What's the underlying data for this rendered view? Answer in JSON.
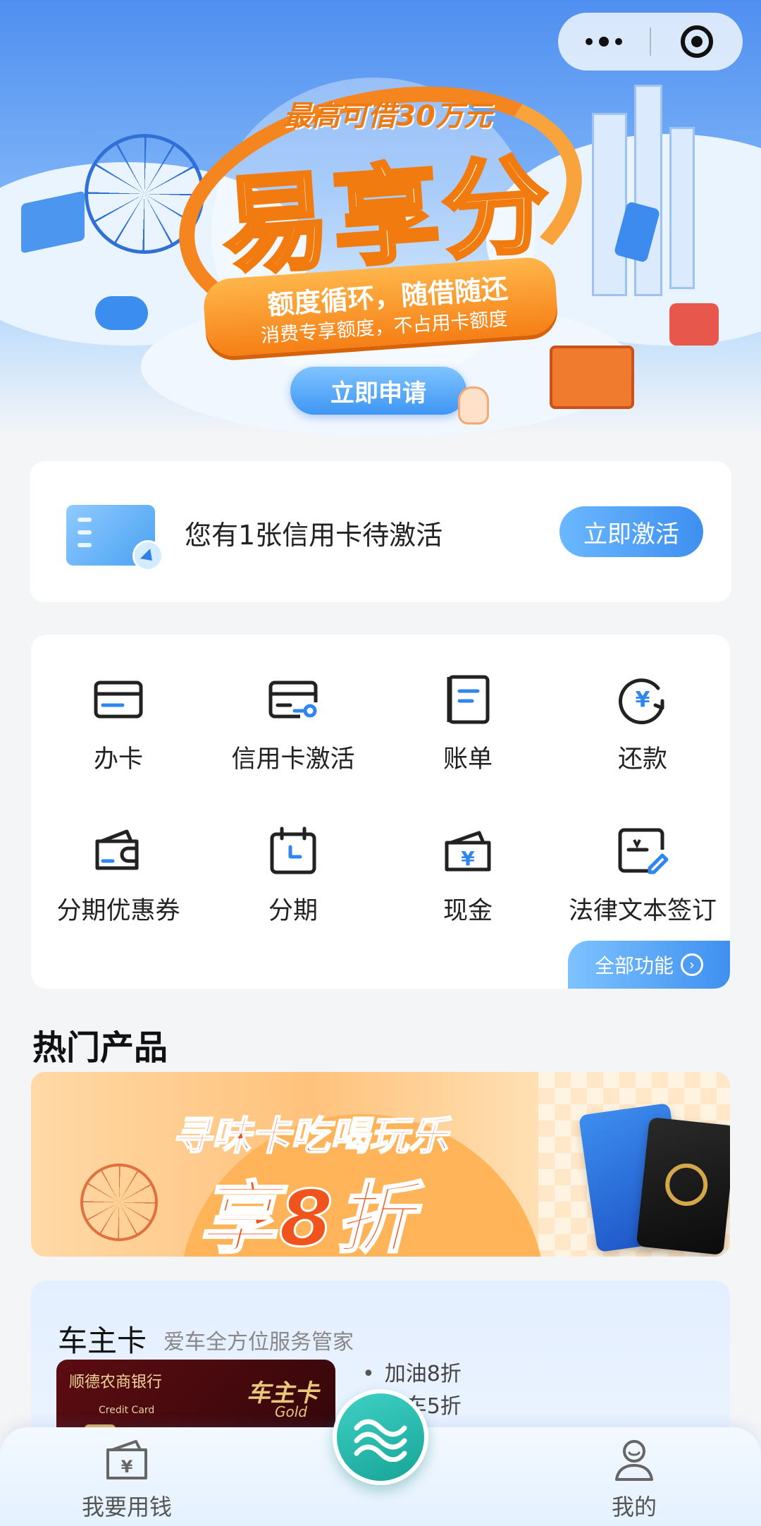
{
  "banner": {
    "subtitle": "最高可借30万元",
    "title": "易享分",
    "ribbon_line1": "额度循环，随借随还",
    "ribbon_line2": "消费专享额度，不占用卡额度",
    "apply_label": "立即申请"
  },
  "capsule": {
    "more_icon": "more-dots-icon",
    "close_icon": "close-miniprogram-icon"
  },
  "activation": {
    "message": "您有1张信用卡待激活",
    "button_label": "立即激活"
  },
  "functions": {
    "items": [
      {
        "label": "办卡",
        "icon": "card-icon"
      },
      {
        "label": "信用卡激活",
        "icon": "card-activate-icon"
      },
      {
        "label": "账单",
        "icon": "bill-icon"
      },
      {
        "label": "还款",
        "icon": "repay-icon"
      },
      {
        "label": "分期优惠券",
        "icon": "coupon-wallet-icon"
      },
      {
        "label": "分期",
        "icon": "calendar-icon"
      },
      {
        "label": "现金",
        "icon": "cash-icon"
      },
      {
        "label": "法律文本签订",
        "icon": "sign-document-icon"
      }
    ],
    "all_label": "全部功能"
  },
  "hot_products": {
    "title": "热门产品",
    "promo_line1": "寻味卡吃喝玩乐",
    "promo_line2": "享8折"
  },
  "car_card": {
    "title": "车主卡",
    "subtitle": "爱车全方位服务管家",
    "card_bank": "顺德农商银行",
    "card_type": "Credit Card",
    "card_brand": "车主卡",
    "card_tier": "Gold",
    "benefits": [
      "加油8折",
      "洗车5折",
      "…"
    ]
  },
  "tabbar": {
    "left_label": "我要用钱",
    "right_label": "我的"
  },
  "colors": {
    "accent_blue": "#3e8ff0",
    "teal": "#17a497",
    "orange": "#f27b10"
  }
}
